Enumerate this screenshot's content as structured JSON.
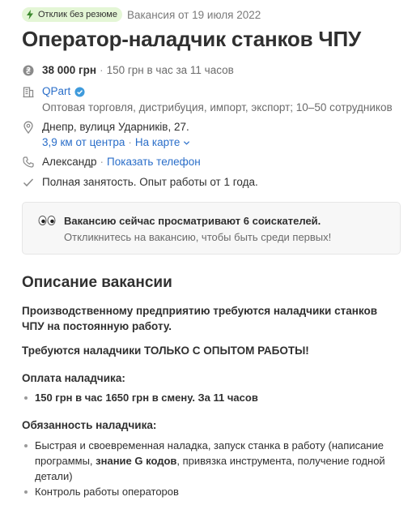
{
  "badge": {
    "label": "Отклик без резюме"
  },
  "posted": "Вакансия от 19 июля 2022",
  "title": "Оператор-наладчик станков ЧПУ",
  "salary": {
    "amount": "38 000 грн",
    "separator": "·",
    "details": "150 грн в час за 11 часов"
  },
  "company": {
    "name": "QPart",
    "description": "Оптовая торговля, дистрибуция, импорт, экспорт; 10–50 сотрудников"
  },
  "location": {
    "address": "Днепр, вулиця Ударників, 27.",
    "distance_link": "3,9 км от центра",
    "separator": "·",
    "map_link": "На карте"
  },
  "contact": {
    "name": "Александр",
    "separator": "·",
    "phone_link": "Показать телефон"
  },
  "employment": "Полная занятость. Опыт работы от 1 года.",
  "notice": {
    "headline": "Вакансию сейчас просматривают 6 соискателей.",
    "subtext": "Откликнитесь на вакансию, чтобы быть среди первых!"
  },
  "description": {
    "heading": "Описание вакансии",
    "intro": "Производственному предприятию требуются наладчики станков ЧПУ на постоянную работу.",
    "experience": "Требуются наладчики ТОЛЬКО С ОПЫТОМ РАБОТЫ!",
    "pay_heading": "Оплата наладчика:",
    "pay_items": [
      "150 грн в час 1650 грн в смену. За 11 часов"
    ],
    "duties_heading": "Обязанность наладчика:",
    "duty_1_part1": "Быстрая и своевременная наладка, запуск станка в работу (написание программы, ",
    "duty_1_bold": "знание G кодов",
    "duty_1_part2": ", привязка инструмента, получение годной детали)",
    "duty_2": "Контроль работы операторов"
  },
  "colors": {
    "accent_link": "#2a6ec9",
    "badge_bg": "#e4f6d6",
    "verified": "#3f9bdc"
  },
  "icons": [
    "lightning-icon",
    "money-icon",
    "building-icon",
    "verified-icon",
    "location-pin-icon",
    "chevron-down-icon",
    "phone-icon",
    "checkmark-icon",
    "eyes-icon"
  ]
}
